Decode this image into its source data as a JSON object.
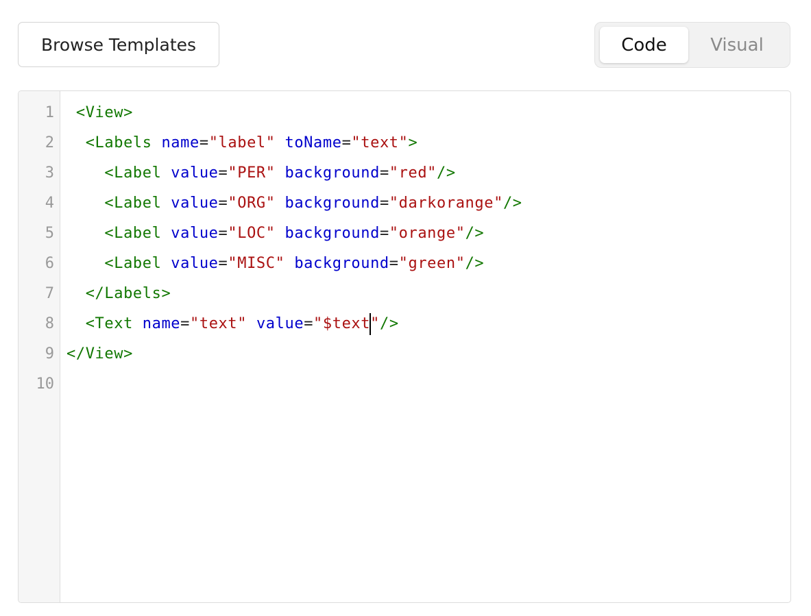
{
  "toolbar": {
    "browse_label": "Browse Templates",
    "toggle": {
      "code_label": "Code",
      "visual_label": "Visual",
      "selected": "Code"
    }
  },
  "editor": {
    "line_numbers": [
      "1",
      "2",
      "3",
      "4",
      "5",
      "6",
      "7",
      "8",
      "9",
      "10"
    ],
    "lines": [
      [
        {
          "t": "tag",
          "v": " <View>"
        }
      ],
      [
        {
          "t": "tag",
          "v": "  <Labels "
        },
        {
          "t": "attr",
          "v": "name"
        },
        {
          "t": "plain",
          "v": "="
        },
        {
          "t": "str",
          "v": "\"label\""
        },
        {
          "t": "plain",
          "v": " "
        },
        {
          "t": "attr",
          "v": "toName"
        },
        {
          "t": "plain",
          "v": "="
        },
        {
          "t": "str",
          "v": "\"text\""
        },
        {
          "t": "tag",
          "v": ">"
        }
      ],
      [
        {
          "t": "tag",
          "v": "    <Label "
        },
        {
          "t": "attr",
          "v": "value"
        },
        {
          "t": "plain",
          "v": "="
        },
        {
          "t": "str",
          "v": "\"PER\""
        },
        {
          "t": "plain",
          "v": " "
        },
        {
          "t": "attr",
          "v": "background"
        },
        {
          "t": "plain",
          "v": "="
        },
        {
          "t": "str",
          "v": "\"red\""
        },
        {
          "t": "tag",
          "v": "/>"
        }
      ],
      [
        {
          "t": "tag",
          "v": "    <Label "
        },
        {
          "t": "attr",
          "v": "value"
        },
        {
          "t": "plain",
          "v": "="
        },
        {
          "t": "str",
          "v": "\"ORG\""
        },
        {
          "t": "plain",
          "v": " "
        },
        {
          "t": "attr",
          "v": "background"
        },
        {
          "t": "plain",
          "v": "="
        },
        {
          "t": "str",
          "v": "\"darkorange\""
        },
        {
          "t": "tag",
          "v": "/>"
        }
      ],
      [
        {
          "t": "tag",
          "v": "    <Label "
        },
        {
          "t": "attr",
          "v": "value"
        },
        {
          "t": "plain",
          "v": "="
        },
        {
          "t": "str",
          "v": "\"LOC\""
        },
        {
          "t": "plain",
          "v": " "
        },
        {
          "t": "attr",
          "v": "background"
        },
        {
          "t": "plain",
          "v": "="
        },
        {
          "t": "str",
          "v": "\"orange\""
        },
        {
          "t": "tag",
          "v": "/>"
        }
      ],
      [
        {
          "t": "tag",
          "v": "    <Label "
        },
        {
          "t": "attr",
          "v": "value"
        },
        {
          "t": "plain",
          "v": "="
        },
        {
          "t": "str",
          "v": "\"MISC\""
        },
        {
          "t": "plain",
          "v": " "
        },
        {
          "t": "attr",
          "v": "background"
        },
        {
          "t": "plain",
          "v": "="
        },
        {
          "t": "str",
          "v": "\"green\""
        },
        {
          "t": "tag",
          "v": "/>"
        }
      ],
      [
        {
          "t": "tag",
          "v": "  </Labels>"
        }
      ],
      [
        {
          "t": "tag",
          "v": "  <Text "
        },
        {
          "t": "attr",
          "v": "name"
        },
        {
          "t": "plain",
          "v": "="
        },
        {
          "t": "str",
          "v": "\"text\""
        },
        {
          "t": "plain",
          "v": " "
        },
        {
          "t": "attr",
          "v": "value"
        },
        {
          "t": "plain",
          "v": "="
        },
        {
          "t": "str",
          "v": "\"$text"
        },
        {
          "t": "caret",
          "v": ""
        },
        {
          "t": "str",
          "v": "\""
        },
        {
          "t": "tag",
          "v": "/>"
        }
      ],
      [
        {
          "t": "tag",
          "v": "</View>"
        }
      ],
      []
    ]
  },
  "colors": {
    "tag": "#117700",
    "attribute": "#0000cc",
    "string": "#aa1111"
  }
}
